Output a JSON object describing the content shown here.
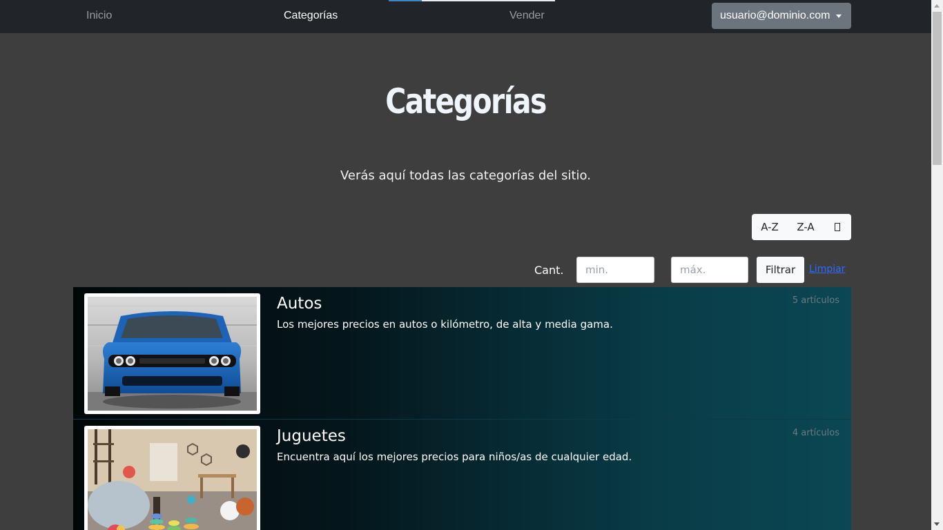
{
  "nav": {
    "links": [
      {
        "label": "Inicio"
      },
      {
        "label": "Categorías"
      },
      {
        "label": "Vender"
      }
    ],
    "user_label": "usuario@dominio.com"
  },
  "page": {
    "title": "Categorías",
    "lead": "Verás aquí todas las categorías del sitio."
  },
  "sort": {
    "az_label": "A-Z",
    "za_label": "Z-A",
    "count_icon": "missing-glyph-icon"
  },
  "filter": {
    "cant_label": "Cant.",
    "min_placeholder": "min.",
    "max_placeholder": "máx.",
    "filter_label": "Filtrar",
    "clear_label": "Limpiar"
  },
  "categories": [
    {
      "name": "Autos",
      "description": "Los mejores precios en autos o kilómetro, de alta y media gama.",
      "count": "5 artículos"
    },
    {
      "name": "Juguetes",
      "description": "Encuentra aquí los mejores precios para niños/as de cualquier edad.",
      "count": "4 artículos"
    }
  ],
  "colors": {
    "navbar_bg": "#212529",
    "page_bg": "#3e3e3e",
    "user_button_bg": "#6c757d",
    "link": "#2f6bff",
    "list_gradient_end": "#0b4754"
  }
}
